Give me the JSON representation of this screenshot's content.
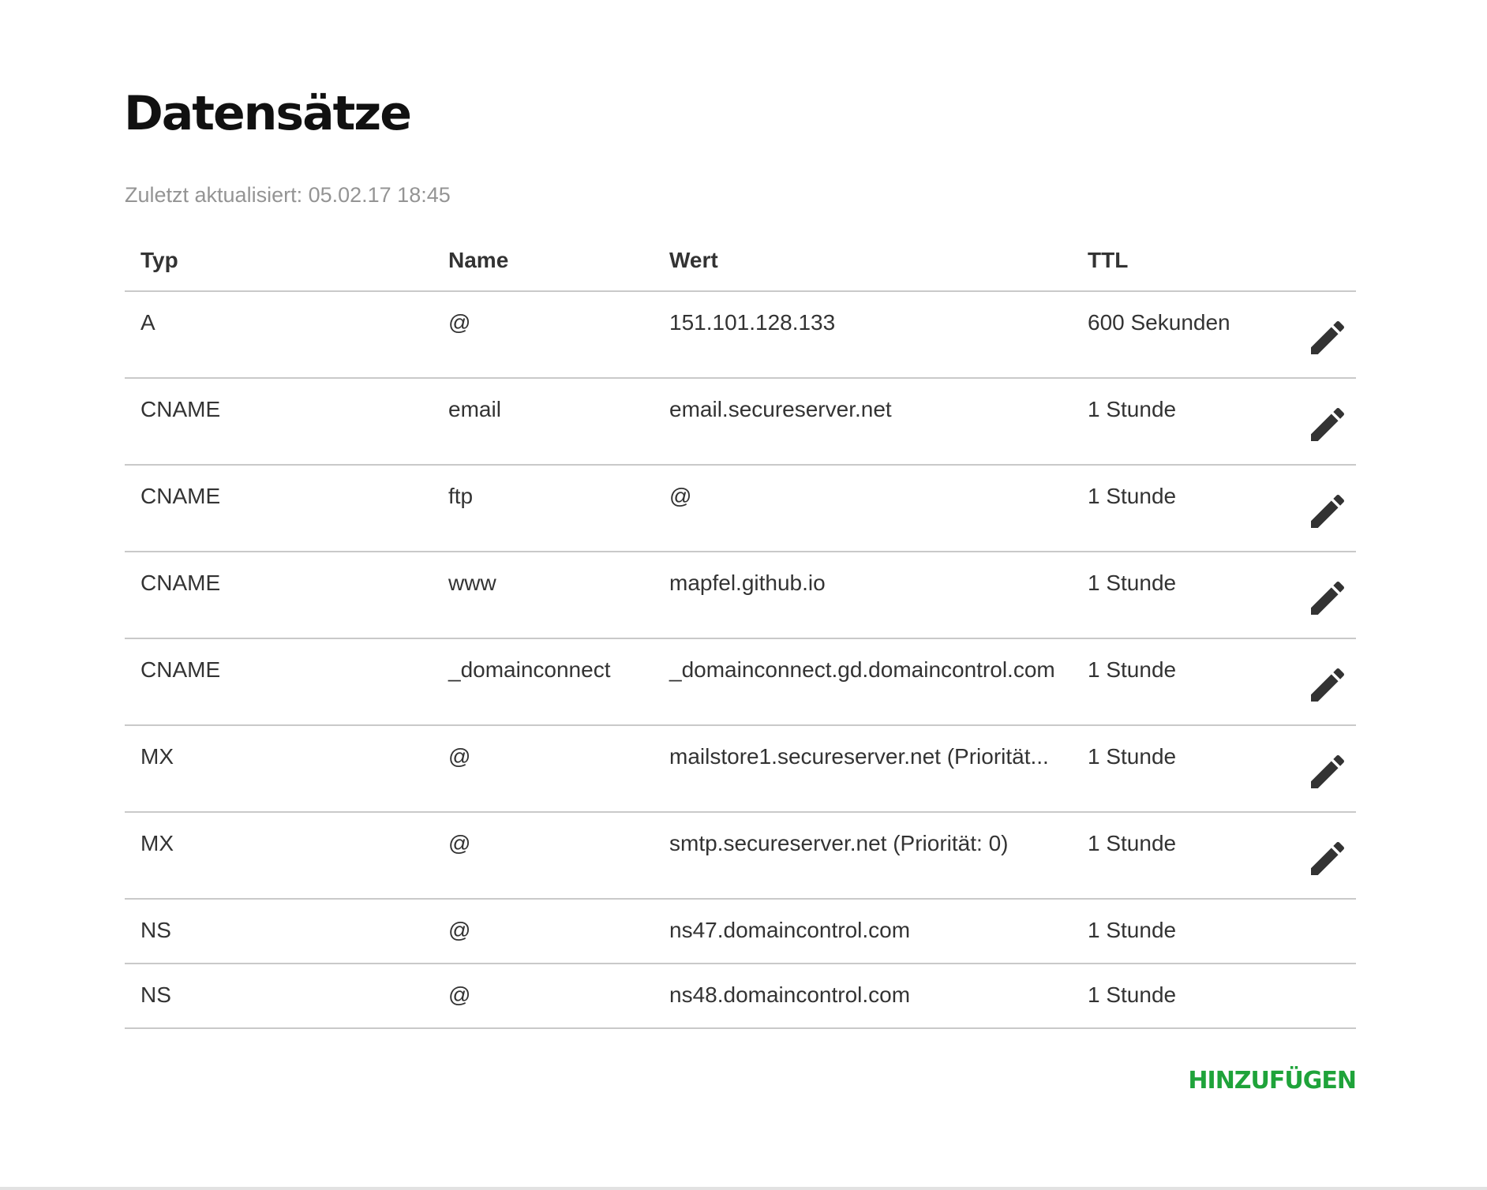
{
  "page": {
    "title": "Datensätze",
    "last_updated": "Zuletzt aktualisiert: 05.02.17 18:45",
    "add_label": "HINZUFÜGEN",
    "accent_color": "#1fa33a"
  },
  "table": {
    "headers": {
      "typ": "Typ",
      "name": "Name",
      "wert": "Wert",
      "ttl": "TTL"
    },
    "rows": [
      {
        "typ": "A",
        "name": "@",
        "wert": "151.101.128.133",
        "ttl": "600 Sekunden",
        "editable": true
      },
      {
        "typ": "CNAME",
        "name": "email",
        "wert": "email.secureserver.net",
        "ttl": "1 Stunde",
        "editable": true
      },
      {
        "typ": "CNAME",
        "name": "ftp",
        "wert": "@",
        "ttl": "1 Stunde",
        "editable": true
      },
      {
        "typ": "CNAME",
        "name": "www",
        "wert": "mapfel.github.io",
        "ttl": "1 Stunde",
        "editable": true
      },
      {
        "typ": "CNAME",
        "name": "_domainconnect",
        "wert": "_domainconnect.gd.domaincontrol.com",
        "ttl": "1 Stunde",
        "editable": true
      },
      {
        "typ": "MX",
        "name": "@",
        "wert": "mailstore1.secureserver.net (Priorität...",
        "ttl": "1 Stunde",
        "editable": true
      },
      {
        "typ": "MX",
        "name": "@",
        "wert": "smtp.secureserver.net (Priorität: 0)",
        "ttl": "1 Stunde",
        "editable": true
      },
      {
        "typ": "NS",
        "name": "@",
        "wert": "ns47.domaincontrol.com",
        "ttl": "1 Stunde",
        "editable": false
      },
      {
        "typ": "NS",
        "name": "@",
        "wert": "ns48.domaincontrol.com",
        "ttl": "1 Stunde",
        "editable": false
      }
    ],
    "edit_icon": "pencil-icon"
  }
}
